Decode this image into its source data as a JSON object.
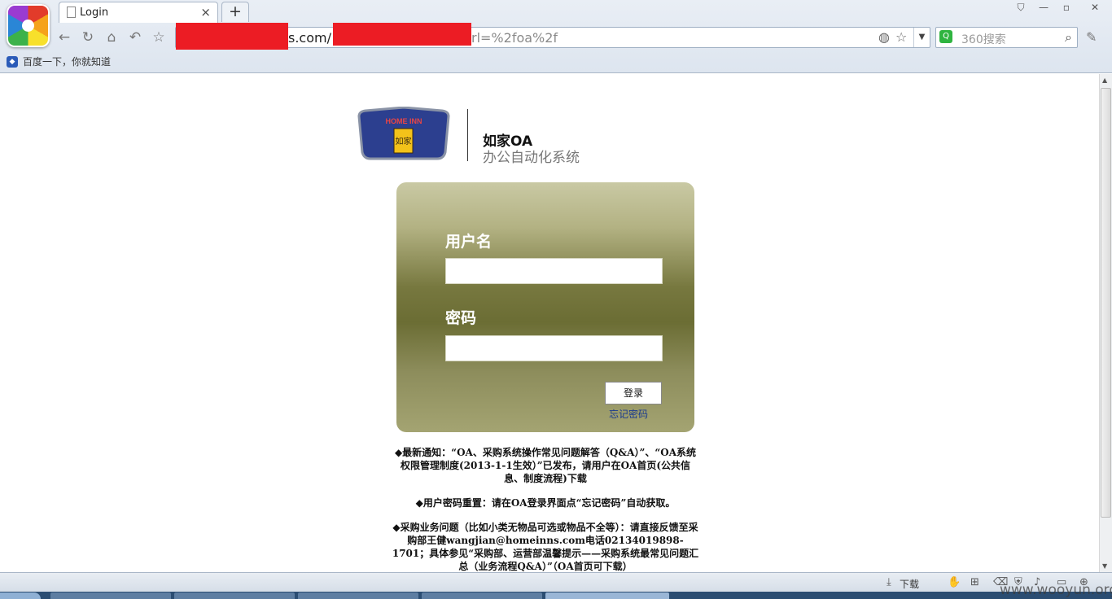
{
  "browser": {
    "tab_title": "Login",
    "tab_close": "×",
    "new_tab": "+",
    "url_visible_mid": "s.com/",
    "url_visible_end": "rl=%2foa%2f",
    "search_placeholder": "360搜索",
    "favorites": [
      {
        "label": "百度一下，你就知道"
      }
    ],
    "window_buttons": [
      "—",
      "▫",
      "✕"
    ]
  },
  "brand": {
    "logo_text_top": "HOME INN",
    "logo_text_main": "如家",
    "system_name": "如家OA",
    "system_desc": "办公自动化系统"
  },
  "login": {
    "username_label": "用户名",
    "username_value": "",
    "password_label": "密码",
    "password_value": "",
    "submit_label": "登录",
    "forgot_label": "忘记密码"
  },
  "notices": [
    "◆最新通知：“OA、采购系统操作常见问题解答（Q&A）”、“OA系统权限管理制度(2013-1-1生效）”已发布，请用户在OA首页(公共信息、制度流程)下载",
    "◆用户密码重置：请在OA登录界面点“忘记密码”自动获取。",
    "◆采购业务问题（比如小类无物品可选或物品不全等）：请直接反馈至采购部王健wangjian@homeinns.com电话02134019898-1701；具体参见“采购部、运营部温馨提示——采购系统最常见问题汇总（业务流程Q&A）”（OA首页可下载）"
  ],
  "statusbar": {
    "download_label": "下载"
  },
  "watermark": "www.wooyun.org",
  "colors": {
    "redaction": "#ec1c24",
    "login_panel_top": "#c9c9a4",
    "login_panel_mid": "#6b6d34",
    "logo_blue": "#2c3f8f",
    "logo_gold": "#f3c21a"
  }
}
